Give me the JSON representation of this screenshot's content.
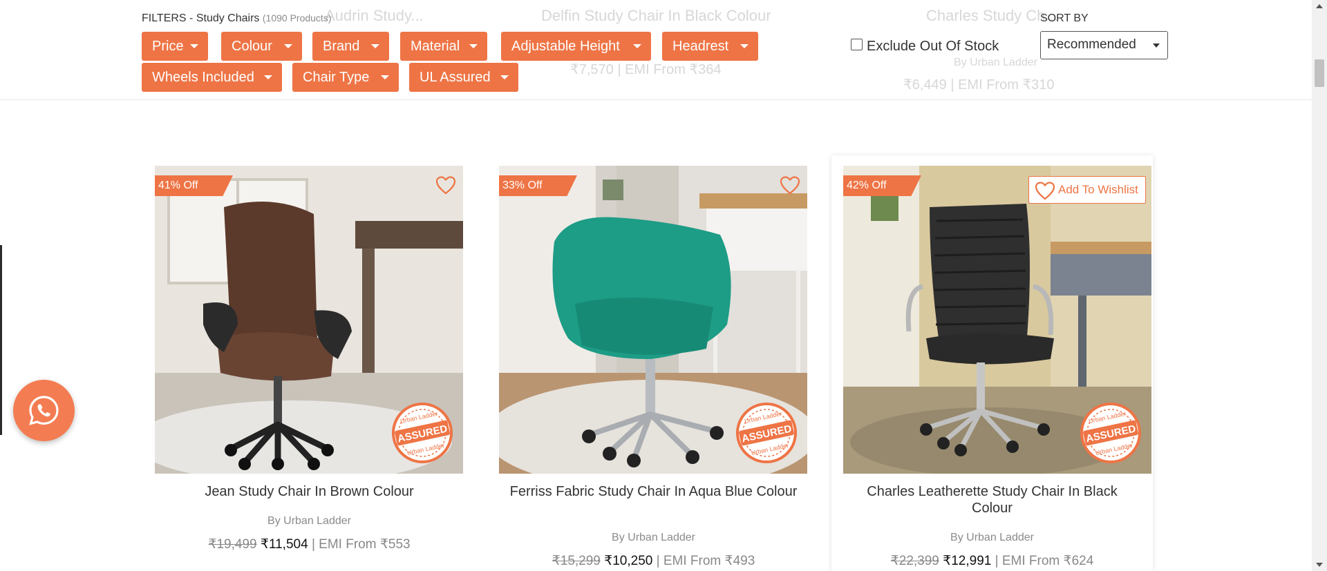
{
  "filters": {
    "label": "FILTERS - Study Chairs",
    "count": "(1090 Products)",
    "chips": [
      "Price",
      "Colour",
      "Brand",
      "Material",
      "Adjustable Height",
      "Headrest",
      "Wheels Included",
      "Chair Type",
      "UL Assured"
    ]
  },
  "exclude_out_of_stock": {
    "label": "Exclude Out Of Stock",
    "checked": false
  },
  "sort": {
    "label": "SORT BY",
    "selected": "Recommended"
  },
  "ghost_previous_row": {
    "titles": [
      "Audrin Study...",
      "Delfin Study Chair In Black Colour",
      "Charles Study Ch..."
    ],
    "prices": [
      "₹7,570 | EMI From ₹364",
      "₹6,449 | EMI From ₹310"
    ],
    "brand": "By Urban Ladder"
  },
  "products": [
    {
      "discount": "41% Off",
      "title": "Jean Study Chair In Brown Colour",
      "brand": "By Urban Ladder",
      "mrp": "₹19,499",
      "price": "₹11,504",
      "emi": "| EMI From ₹553",
      "badge": "ASSURED",
      "badge_brand": "Urban Ladder"
    },
    {
      "discount": "33% Off",
      "title": "Ferriss Fabric Study Chair In Aqua Blue Colour",
      "brand": "By Urban Ladder",
      "mrp": "₹15,299",
      "price": "₹10,250",
      "emi": "| EMI From ₹493",
      "badge": "ASSURED",
      "badge_brand": "Urban Ladder"
    },
    {
      "discount": "42% Off",
      "title": "Charles Leatherette Study Chair In Black Colour",
      "brand": "By Urban Ladder",
      "mrp": "₹22,399",
      "price": "₹12,991",
      "emi": "| EMI From ₹624",
      "wishlist_label": "Add To Wishlist",
      "badge": "ASSURED",
      "badge_brand": "Urban Ladder"
    }
  ],
  "colors": {
    "accent": "#ee7445",
    "text": "#333333",
    "muted": "#8a8a8a"
  },
  "icons": [
    "heart-icon",
    "caret-down-icon",
    "whatsapp-icon",
    "checkbox-icon"
  ]
}
